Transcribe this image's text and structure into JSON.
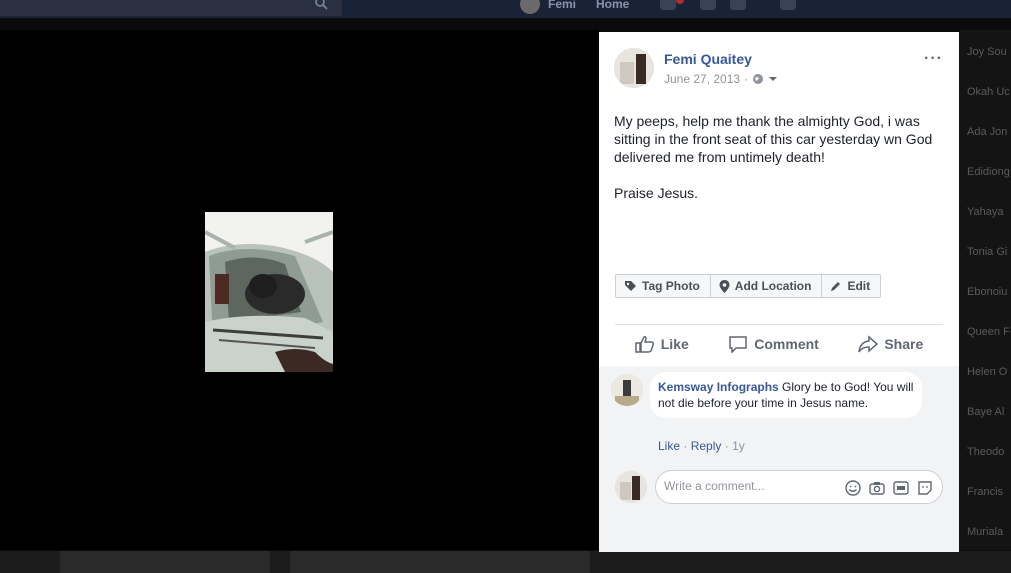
{
  "topbar": {
    "profile_name": "Femi",
    "home_label": "Home"
  },
  "post": {
    "author": "Femi Quaitey",
    "date": "June 27, 2013",
    "separator": "·",
    "more_label": "···",
    "text_line1": "My peeps, help me thank the almighty God, i was sitting in the front seat of this car yesterday wn God delivered me from untimely death!",
    "text_line2": "Praise Jesus."
  },
  "photo_actions": {
    "tag_photo": "Tag Photo",
    "add_location": "Add Location",
    "edit": "Edit"
  },
  "actions": {
    "like": "Like",
    "comment": "Comment",
    "share": "Share"
  },
  "comment": {
    "author": "Kemsway Infographs",
    "text": "Glory be to God! You will not die before your time in Jesus name.",
    "like": "Like",
    "reply": "Reply",
    "dot": "·",
    "time": "1y"
  },
  "write_comment": {
    "placeholder": "Write a comment..."
  },
  "sidebar_friends": [
    "Joy Sou",
    "Okah Uc",
    "Ada Jon",
    "Edidiong",
    "Yahaya",
    "Tonia Gi",
    "Ebonoiu",
    "Queen F",
    "Helen O",
    "Baye Al",
    "Theodo",
    "Francis",
    "Muriala"
  ],
  "colors": {
    "link": "#385898",
    "muted": "#90949c",
    "panel_bg": "#ffffff",
    "viewer_bg": "#000000"
  }
}
